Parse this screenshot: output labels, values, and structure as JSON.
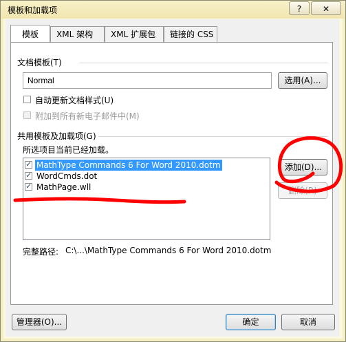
{
  "dialog": {
    "title": "模板和加载项",
    "help_glyph": "?",
    "close_glyph": "✕"
  },
  "tabs": [
    {
      "label": "模板",
      "active": true
    },
    {
      "label": "XML 架构",
      "active": false
    },
    {
      "label": "XML 扩展包",
      "active": false
    },
    {
      "label": "链接的 CSS",
      "active": false
    }
  ],
  "document_template": {
    "group_label": "文档模板(T)",
    "value": "Normal",
    "attach_button": "选用(A)...",
    "auto_update_label": "自动更新文档样式(U)",
    "auto_update_checked": false,
    "attach_all_label": "附加到所有新电子邮件中(M)",
    "attach_all_checked": false,
    "attach_all_enabled": false
  },
  "global_templates": {
    "group_label": "共用模板及加载项(G)",
    "hint": "所选项目当前已经加载。",
    "items": [
      {
        "label": "MathType Commands 6 For Word 2010.dotm",
        "checked": true,
        "selected": true
      },
      {
        "label": "WordCmds.dot",
        "checked": true,
        "selected": false
      },
      {
        "label": "MathPage.wll",
        "checked": true,
        "selected": false
      }
    ],
    "add_button": "添加(D)...",
    "remove_button": "删除(R)",
    "full_path_label": "完整路径:",
    "full_path_value": "C:\\...\\MathType Commands 6 For Word 2010.dotm"
  },
  "footer": {
    "organizer_button": "管理器(O)...",
    "ok_button": "确定",
    "cancel_button": "取消"
  },
  "annotation_color": "#ff0000"
}
